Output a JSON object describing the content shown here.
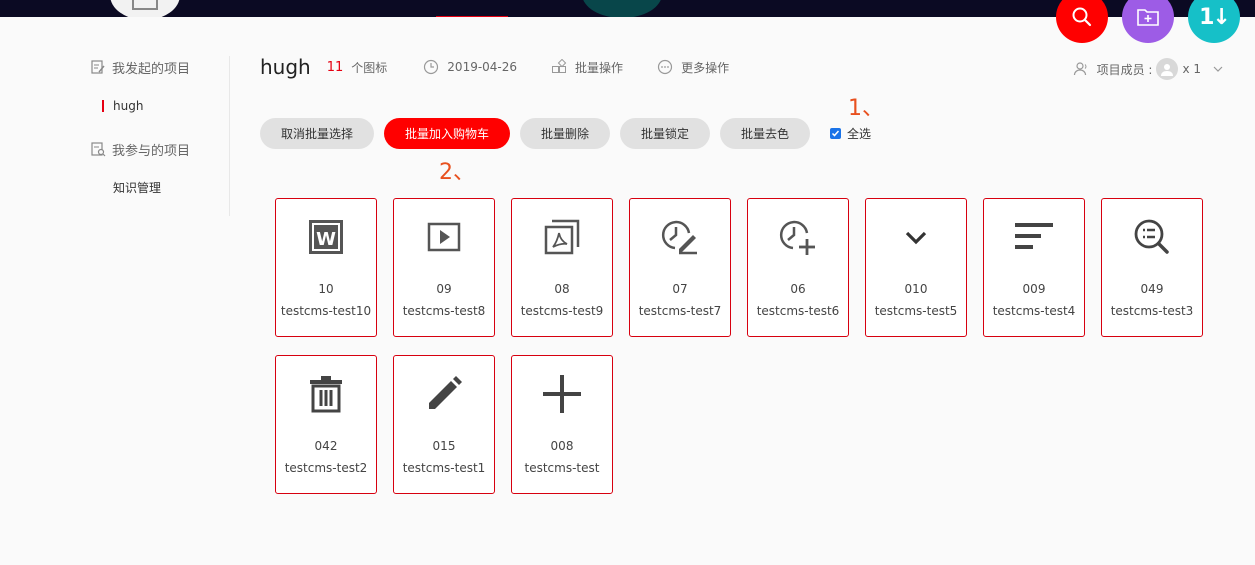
{
  "nav": {
    "fab_sort_label": "1↓"
  },
  "sidebar": {
    "my_projects_heading": "我发起的项目",
    "my_projects": [
      {
        "label": "hugh"
      }
    ],
    "joined_projects_heading": "我参与的项目",
    "joined_projects": [
      {
        "label": "知识管理"
      }
    ]
  },
  "header": {
    "title": "hugh",
    "icon_count": "11",
    "icon_count_label": "个图标",
    "date": "2019-04-26",
    "batch_label": "批量操作",
    "more_label": "更多操作",
    "members_label": "项目成员 :",
    "members_count": "x 1"
  },
  "actions": {
    "cancel_batch": "取消批量选择",
    "add_to_cart": "批量加入购物车",
    "batch_delete": "批量删除",
    "batch_lock": "批量锁定",
    "batch_decolor": "批量去色",
    "select_all": "全选"
  },
  "annotations": {
    "one": "1、",
    "two": "2、"
  },
  "icons": [
    {
      "num": "10",
      "name": "testcms-test10",
      "icon": "word-icon"
    },
    {
      "num": "09",
      "name": "testcms-test8",
      "icon": "play-icon"
    },
    {
      "num": "08",
      "name": "testcms-test9",
      "icon": "pdf-icon"
    },
    {
      "num": "07",
      "name": "testcms-test7",
      "icon": "clock-edit-icon"
    },
    {
      "num": "06",
      "name": "testcms-test6",
      "icon": "clock-add-icon"
    },
    {
      "num": "010",
      "name": "testcms-test5",
      "icon": "chevron-down-icon"
    },
    {
      "num": "009",
      "name": "testcms-test4",
      "icon": "text-align-icon"
    },
    {
      "num": "049",
      "name": "testcms-test3",
      "icon": "search-list-icon"
    },
    {
      "num": "042",
      "name": "testcms-test2",
      "icon": "trash-icon"
    },
    {
      "num": "015",
      "name": "testcms-test1",
      "icon": "pencil-icon"
    },
    {
      "num": "008",
      "name": "testcms-test",
      "icon": "plus-icon"
    }
  ],
  "colors": {
    "accent": "#ff0000",
    "card_border": "#d7000f",
    "annotation": "#e8501e",
    "topbar": "#0b0a23"
  }
}
